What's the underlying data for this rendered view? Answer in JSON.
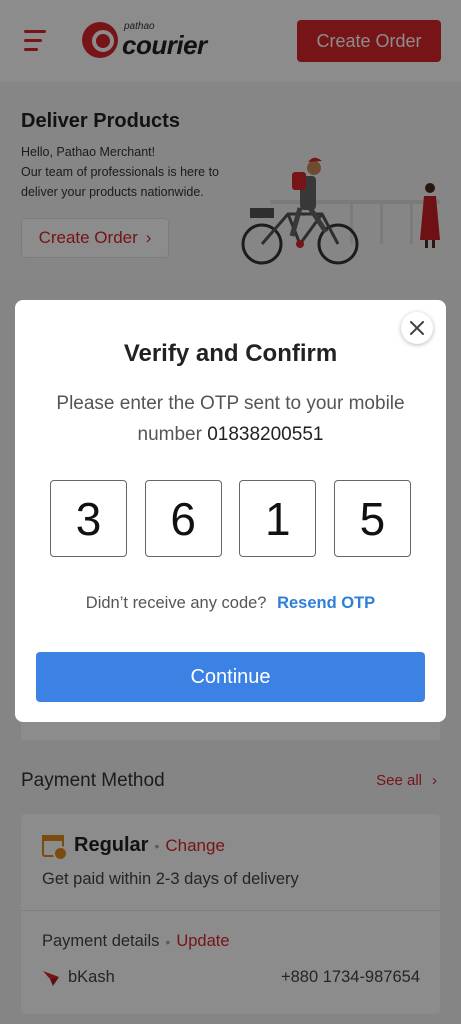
{
  "header": {
    "logo_small": "pathao",
    "logo_big": "courier",
    "create_order_label": "Create Order"
  },
  "banner": {
    "title": "Deliver Products",
    "greeting": "Hello, Pathao Merchant!",
    "tagline": "Our team of professionals is here to deliver your products nationwide.",
    "button_label": "Create Order",
    "button_chevron": "›"
  },
  "payment": {
    "section_title": "Payment Method",
    "see_all_label": "See all",
    "see_all_chevron": "›",
    "plan_name": "Regular",
    "separator": "•",
    "change_label": "Change",
    "plan_desc": "Get paid within 2-3 days of delivery",
    "details_label": "Payment details",
    "update_label": "Update",
    "method_name": "bKash",
    "method_number": "+880 1734-987654"
  },
  "modal": {
    "title": "Verify and Confirm",
    "message": "Please enter the OTP sent to your mobile number",
    "phone": "01838200551",
    "otp_digits": [
      "3",
      "6",
      "1",
      "5"
    ],
    "resend_prompt": "Didn’t receive any code?",
    "resend_label": "Resend OTP",
    "continue_label": "Continue",
    "close_symbol": "✕"
  },
  "colors": {
    "brand_red": "#d8262b",
    "primary_blue": "#3b82e4",
    "link_blue": "#2f7fd8"
  }
}
